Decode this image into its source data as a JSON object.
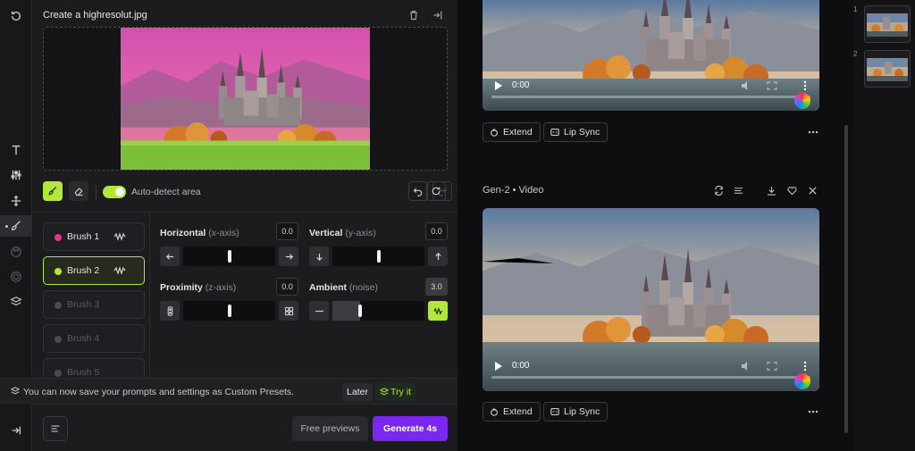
{
  "toolbar": {
    "items": [
      {
        "icon": "history-icon"
      },
      {
        "icon": "text-icon"
      },
      {
        "icon": "sliders-icon"
      },
      {
        "icon": "camera-motion-icon"
      },
      {
        "icon": "motion-brush-icon",
        "active": true
      },
      {
        "icon": "palette-icon"
      },
      {
        "icon": "frame-icon"
      },
      {
        "icon": "layers-icon"
      },
      {
        "icon": "collapse-icon"
      }
    ]
  },
  "editor": {
    "title": "Create a highresolut.jpg",
    "auto_detect_label": "Auto-detect area",
    "auto_detect_on": true,
    "brushes": [
      {
        "label": "Brush 1",
        "color": "#e8348f",
        "selected": false,
        "enabled": true
      },
      {
        "label": "Brush 2",
        "color": "#b3e83a",
        "selected": true,
        "enabled": true
      },
      {
        "label": "Brush 3",
        "color": "#4a4a50",
        "selected": false,
        "enabled": false
      },
      {
        "label": "Brush 4",
        "color": "#4a4a50",
        "selected": false,
        "enabled": false
      },
      {
        "label": "Brush 5",
        "color": "#4a4a50",
        "selected": false,
        "enabled": false
      }
    ],
    "controls": {
      "horizontal": {
        "label": "Horizontal",
        "sub": "(x-axis)",
        "value": "0.0",
        "level": 0.5
      },
      "vertical": {
        "label": "Vertical",
        "sub": "(y-axis)",
        "value": "0.0",
        "level": 0.5
      },
      "proximity": {
        "label": "Proximity",
        "sub": "(z-axis)",
        "value": "0.0",
        "level": 0.5
      },
      "ambient": {
        "label": "Ambient",
        "sub": "(noise)",
        "value": "3.0",
        "level": 0.3
      }
    }
  },
  "notice": {
    "text": "You can now save your prompts and settings as Custom Presets.",
    "later": "Later",
    "try": "Try it"
  },
  "actions": {
    "free_previews": "Free previews",
    "generate": "Generate 4s"
  },
  "gallery": {
    "item1": {
      "time": "0:00",
      "extend": "Extend",
      "lip_sync": "Lip Sync"
    },
    "item2": {
      "title": "Gen-2 • Video",
      "time": "0:00",
      "extend": "Extend",
      "lip_sync": "Lip Sync"
    }
  },
  "thumbnails": [
    {
      "number": "1"
    },
    {
      "number": "2"
    }
  ],
  "colors": {
    "accent": "#b3e83a",
    "generate": "#7a28f0"
  }
}
